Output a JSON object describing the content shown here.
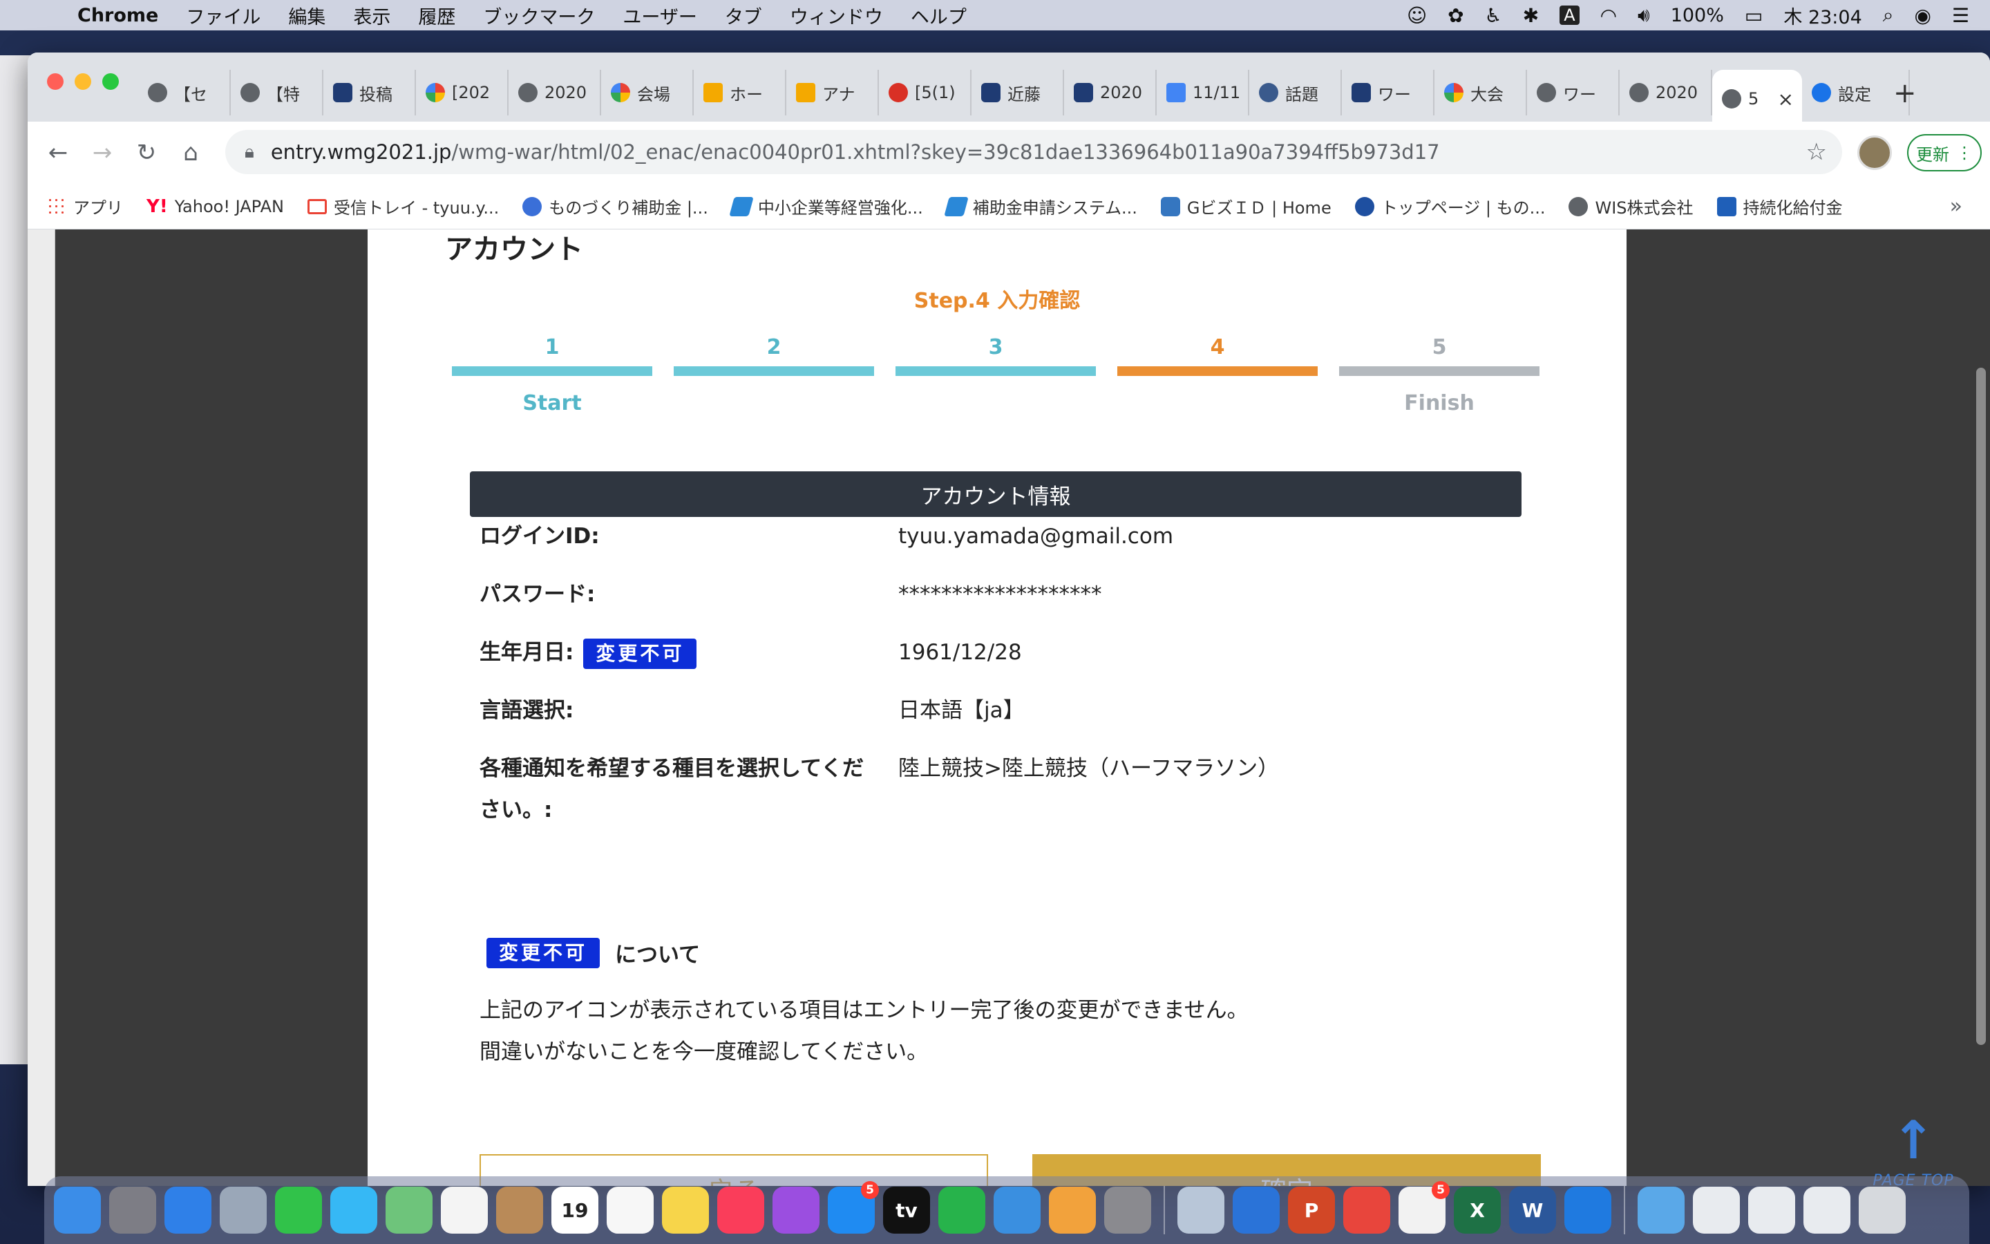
{
  "menubar": {
    "app": "Chrome",
    "items": [
      "ファイル",
      "編集",
      "表示",
      "履歴",
      "ブックマーク",
      "ユーザー",
      "タブ",
      "ウィンドウ",
      "ヘルプ"
    ],
    "battery": "100%",
    "clock": "木 23:04",
    "input_mode": "A"
  },
  "tabs": [
    {
      "title": "【セ",
      "icon": "globe-icon"
    },
    {
      "title": "【特",
      "icon": "globe-icon"
    },
    {
      "title": "投稿",
      "icon": "doc-icon"
    },
    {
      "title": "[202",
      "icon": "multicolor-icon"
    },
    {
      "title": "2020",
      "icon": "globe-icon"
    },
    {
      "title": "会場",
      "icon": "multicolor-icon"
    },
    {
      "title": "ホー",
      "icon": "ads-icon"
    },
    {
      "title": "アナ",
      "icon": "analytics-icon"
    },
    {
      "title": "[5(1)",
      "icon": "red-icon"
    },
    {
      "title": "近藤",
      "icon": "doc-icon"
    },
    {
      "title": "2020",
      "icon": "doc-icon"
    },
    {
      "title": "11/11",
      "icon": "docs-icon"
    },
    {
      "title": "話題",
      "icon": "wordpress-icon"
    },
    {
      "title": "ワー",
      "icon": "doc-icon"
    },
    {
      "title": "大会",
      "icon": "multicolor-icon"
    },
    {
      "title": "ワー",
      "icon": "globe-icon"
    },
    {
      "title": "2020",
      "icon": "globe-icon"
    }
  ],
  "active_tab": {
    "title": "5",
    "icon": "globe-icon"
  },
  "settings_tab": {
    "title": "設定",
    "icon": "gear-icon"
  },
  "omnibox": {
    "host": "entry.wmg2021.jp",
    "path": "/wmg-war/html/02_enac/enac0040pr01.xhtml?skey=39c81dae1336964b011a90a7394ff5b973d17"
  },
  "update_button": "更新",
  "bookmarks": [
    {
      "label": "アプリ",
      "icon": "apps-grid-icon"
    },
    {
      "label": "Yahoo! JAPAN",
      "icon": "yahoo-icon"
    },
    {
      "label": "受信トレイ - tyuu.y...",
      "icon": "gmail-icon"
    },
    {
      "label": "ものづくり補助金 |...",
      "icon": "ai-icon"
    },
    {
      "label": "中小企業等経営強化...",
      "icon": "s-icon"
    },
    {
      "label": "補助金申請システム...",
      "icon": "s-icon"
    },
    {
      "label": "GビズＩＤ | Home",
      "icon": "gbiz-icon"
    },
    {
      "label": "トップページ | もの...",
      "icon": "mo-icon"
    },
    {
      "label": "WIS株式会社",
      "icon": "globe-icon"
    },
    {
      "label": "持続化給付金",
      "icon": "square-icon"
    }
  ],
  "page": {
    "heading": "アカウント",
    "step_title": "Step.4 入力確認",
    "steps": [
      {
        "num": "1",
        "label": "Start",
        "state": "done"
      },
      {
        "num": "2",
        "label": "",
        "state": "done"
      },
      {
        "num": "3",
        "label": "",
        "state": "done"
      },
      {
        "num": "4",
        "label": "",
        "state": "current"
      },
      {
        "num": "5",
        "label": "Finish",
        "state": "todo"
      }
    ],
    "section_title": "アカウント情報",
    "fields": {
      "login_id": {
        "label": "ログインID:",
        "value": "tyuu.yamada@gmail.com"
      },
      "password": {
        "label": "パスワード:",
        "value": "*******************"
      },
      "birthdate": {
        "label": "生年月日:",
        "value": "1961/12/28",
        "badge": "変更不可"
      },
      "language": {
        "label": "言語選択:",
        "value": "日本語【ja】"
      },
      "notification": {
        "label_line1": "各種通知を希望する種目を選択してくだ",
        "label_line2": "さい。:",
        "value": "陸上競技>陸上競技（ハーフマラソン）"
      }
    },
    "note": {
      "badge": "変更不可",
      "title": "について",
      "line1": "上記のアイコンが表示されている項目はエントリー完了後の変更ができません。",
      "line2": "間違いがないことを今一度確認してください。"
    },
    "back_button": "戻る",
    "confirm_button": "確定",
    "page_top": "PAGE TOP"
  },
  "dock": {
    "apps": [
      {
        "name": "finder",
        "color": "#3b8de8",
        "badge": ""
      },
      {
        "name": "launchpad",
        "color": "#7d7d85",
        "badge": ""
      },
      {
        "name": "safari",
        "color": "#2f80e8",
        "badge": ""
      },
      {
        "name": "mail-bird",
        "color": "#9aa7b8",
        "badge": ""
      },
      {
        "name": "facetime",
        "color": "#31c24a",
        "badge": ""
      },
      {
        "name": "messages",
        "color": "#36b8f5",
        "badge": ""
      },
      {
        "name": "maps",
        "color": "#6ec47b",
        "badge": ""
      },
      {
        "name": "photos",
        "color": "#f4f4f4",
        "badge": ""
      },
      {
        "name": "contacts",
        "color": "#b98a58",
        "badge": ""
      },
      {
        "name": "calendar",
        "color": "#ffffff",
        "badge": "",
        "text": "19"
      },
      {
        "name": "reminders",
        "color": "#f7f7f7",
        "badge": ""
      },
      {
        "name": "notes",
        "color": "#f7d54a",
        "badge": ""
      },
      {
        "name": "music",
        "color": "#fa3d5a",
        "badge": ""
      },
      {
        "name": "podcasts",
        "color": "#9b4ee0",
        "badge": ""
      },
      {
        "name": "app-store",
        "color": "#1f8bf2",
        "badge": "5"
      },
      {
        "name": "apple-tv",
        "color": "#111111",
        "badge": "",
        "text": "tv"
      },
      {
        "name": "numbers",
        "color": "#27b34b",
        "badge": ""
      },
      {
        "name": "keynote",
        "color": "#3a8fe0",
        "badge": ""
      },
      {
        "name": "pages",
        "color": "#f2a23c",
        "badge": ""
      },
      {
        "name": "system-preferences",
        "color": "#8a8a8f",
        "badge": ""
      },
      {
        "name": "sep",
        "color": "",
        "badge": ""
      },
      {
        "name": "mask-app",
        "color": "#b8c6d8",
        "badge": ""
      },
      {
        "name": "list-app",
        "color": "#2a73d8",
        "badge": ""
      },
      {
        "name": "powerpoint",
        "color": "#d24726",
        "badge": "",
        "text": "P"
      },
      {
        "name": "chrome",
        "color": "#e8453c",
        "badge": ""
      },
      {
        "name": "red-dots-app",
        "color": "#f2f2f2",
        "badge": "5"
      },
      {
        "name": "excel",
        "color": "#1e7145",
        "badge": "",
        "text": "X"
      },
      {
        "name": "word",
        "color": "#2b579a",
        "badge": "",
        "text": "W"
      },
      {
        "name": "bluetooth-app",
        "color": "#1f7ae0",
        "badge": ""
      },
      {
        "name": "sep",
        "color": "",
        "badge": ""
      },
      {
        "name": "applications-folder",
        "color": "#5aa8e8",
        "badge": ""
      },
      {
        "name": "screenshot-1",
        "color": "#e8ebef",
        "badge": ""
      },
      {
        "name": "screenshot-2",
        "color": "#e8ebef",
        "badge": ""
      },
      {
        "name": "screenshot-3",
        "color": "#e8ebef",
        "badge": ""
      },
      {
        "name": "trash",
        "color": "#d6d9dd",
        "badge": ""
      }
    ]
  }
}
